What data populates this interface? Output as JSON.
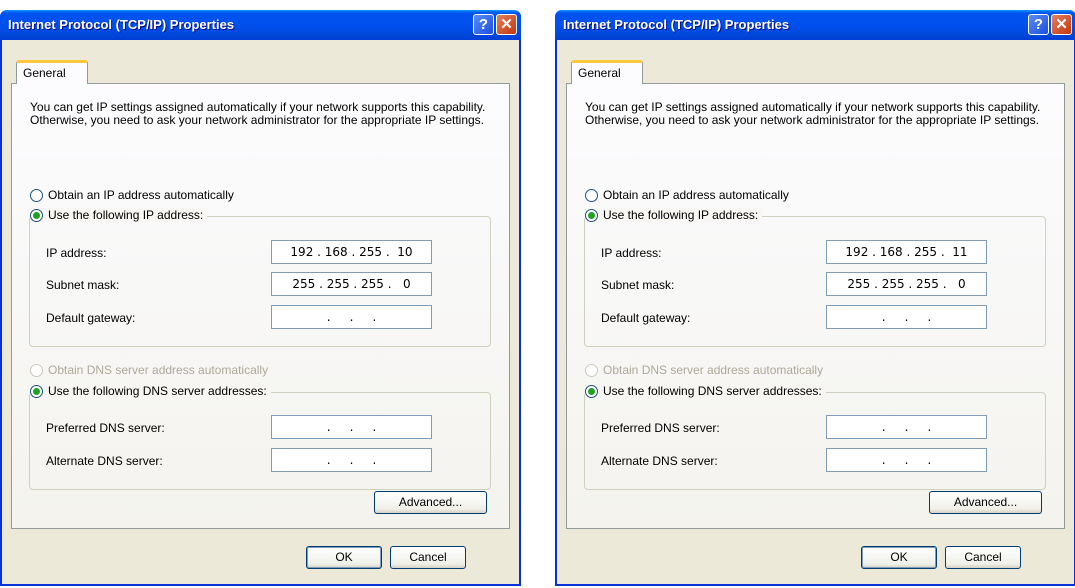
{
  "dialogs": [
    {
      "title": "Internet Protocol (TCP/IP) Properties",
      "help_label": "?",
      "close_label": "✕",
      "tab_label": "General",
      "description": "You can get IP settings assigned automatically if your network supports this capability. Otherwise, you need to ask your network administrator for the appropriate IP settings.",
      "radio_auto_ip": "Obtain an IP address automatically",
      "radio_manual_ip": "Use the following IP address:",
      "ip_label": "IP address:",
      "ip_value": "192 . 168 . 255 .  10",
      "subnet_label": "Subnet mask:",
      "subnet_value": "255 . 255 . 255 .   0",
      "gateway_label": "Default gateway:",
      "gateway_value": "  .     .     .  ",
      "radio_auto_dns": "Obtain DNS server address automatically",
      "radio_manual_dns": "Use the following DNS server addresses:",
      "pref_dns_label": "Preferred DNS server:",
      "pref_dns_value": "  .     .     .  ",
      "alt_dns_label": "Alternate DNS server:",
      "alt_dns_value": "  .     .     .  ",
      "advanced_label": "Advanced...",
      "ok_label": "OK",
      "cancel_label": "Cancel"
    },
    {
      "title": "Internet Protocol (TCP/IP) Properties",
      "help_label": "?",
      "close_label": "✕",
      "tab_label": "General",
      "description": "You can get IP settings assigned automatically if your network supports this capability. Otherwise, you need to ask your network administrator for the appropriate IP settings.",
      "radio_auto_ip": "Obtain an IP address automatically",
      "radio_manual_ip": "Use the following IP address:",
      "ip_label": "IP address:",
      "ip_value": "192 . 168 . 255 .  11",
      "subnet_label": "Subnet mask:",
      "subnet_value": "255 . 255 . 255 .   0",
      "gateway_label": "Default gateway:",
      "gateway_value": "  .     .     .  ",
      "radio_auto_dns": "Obtain DNS server address automatically",
      "radio_manual_dns": "Use the following DNS server addresses:",
      "pref_dns_label": "Preferred DNS server:",
      "pref_dns_value": "  .     .     .  ",
      "alt_dns_label": "Alternate DNS server:",
      "alt_dns_value": "  .     .     .  ",
      "advanced_label": "Advanced...",
      "ok_label": "OK",
      "cancel_label": "Cancel"
    }
  ],
  "colors": {
    "title_bar": "#0054e3",
    "dialog_bg": "#ece9d8",
    "radio_dot": "#21a121",
    "close_button": "#c2360f"
  },
  "icons": {
    "help": "question-mark-icon",
    "close": "close-x-icon"
  }
}
